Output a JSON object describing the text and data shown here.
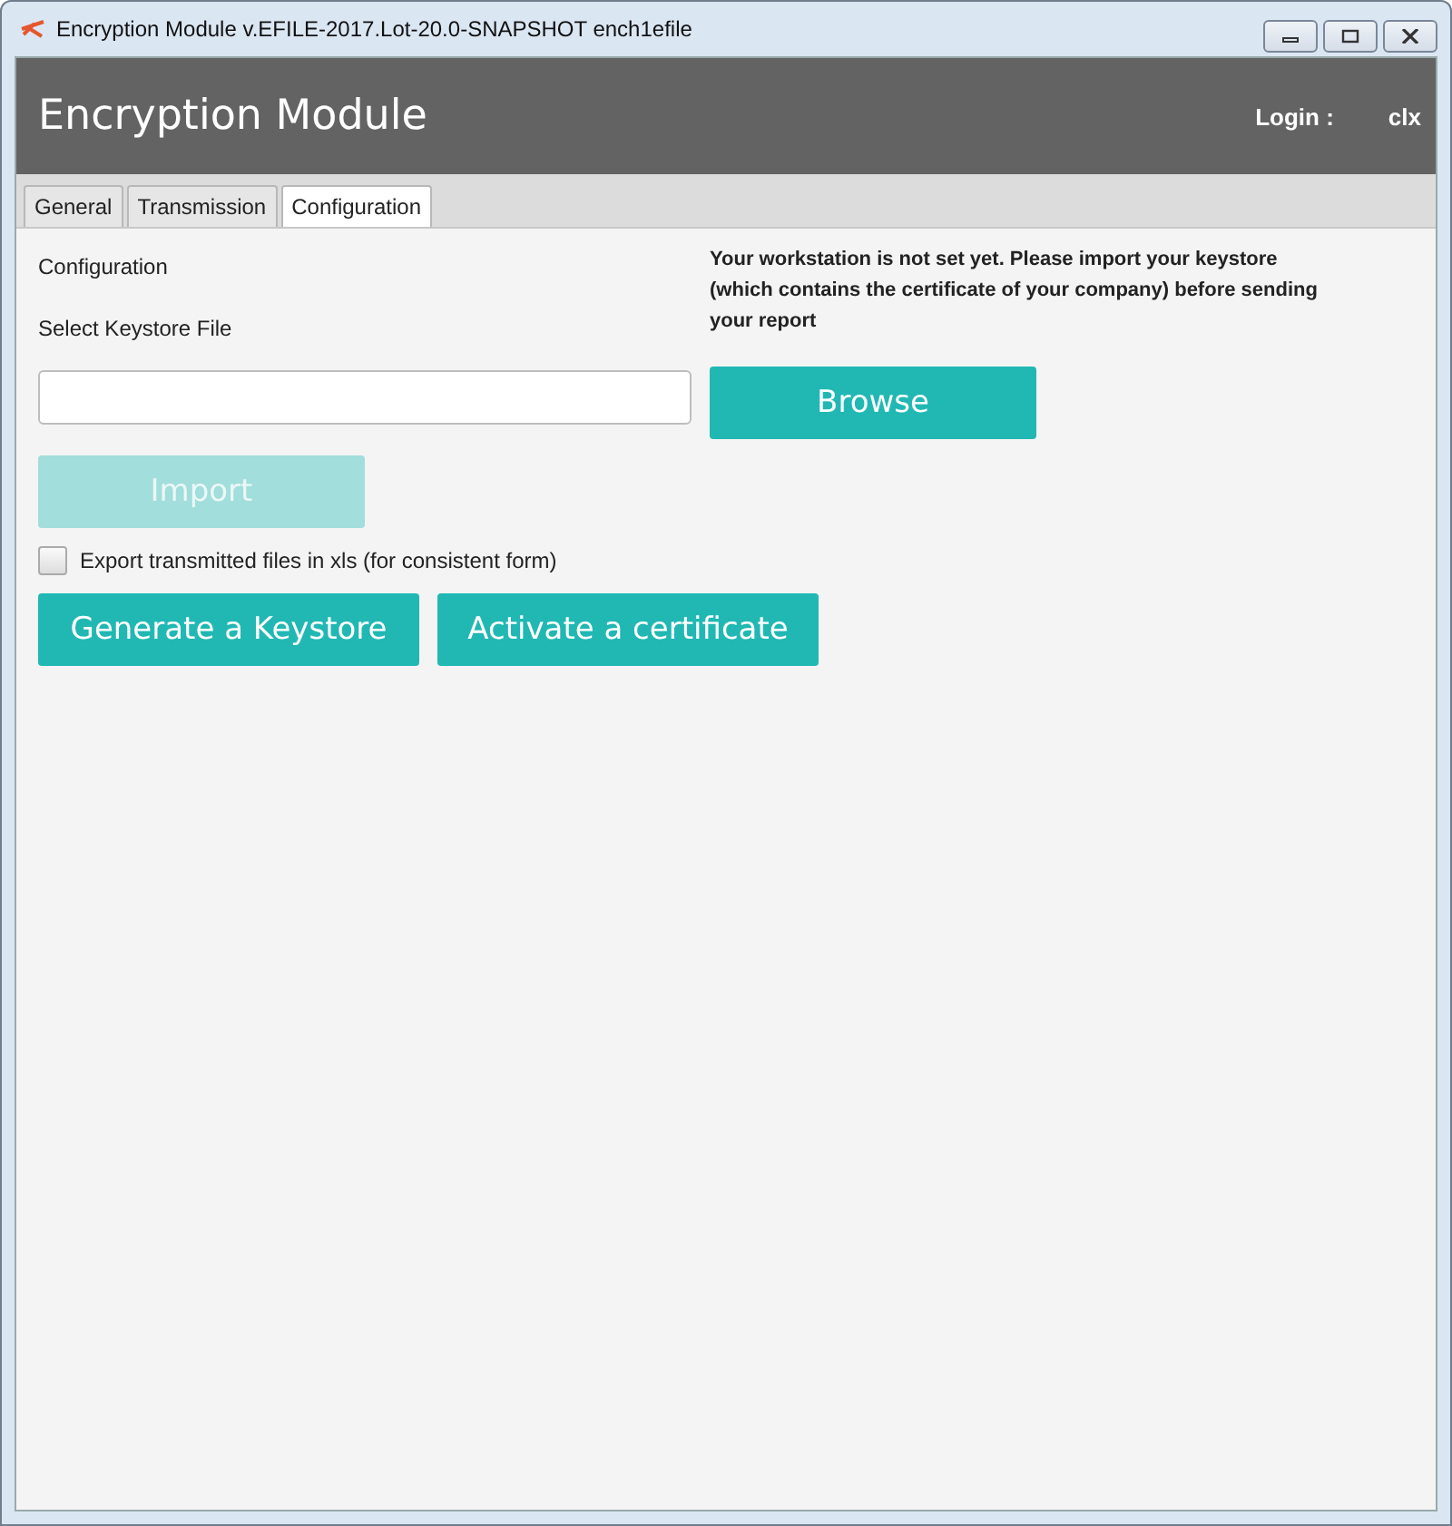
{
  "window": {
    "title": "Encryption Module v.EFILE-2017.Lot-20.0-SNAPSHOT ench1efile"
  },
  "header": {
    "title": "Encryption Module",
    "login_label": "Login :",
    "login_value": "clx"
  },
  "tabs": [
    {
      "label": "General",
      "selected": false
    },
    {
      "label": "Transmission",
      "selected": false
    },
    {
      "label": "Configuration",
      "selected": true
    }
  ],
  "section_title": "Configuration",
  "keystore_label": "Select Keystore File",
  "message": "Your workstation is not set yet. Please import your keystore (which contains the certificate of your company) before sending your report",
  "browse_button": {
    "label": "Browse"
  },
  "import_button": {
    "label": "Import",
    "disabled": true
  },
  "export_checkbox": {
    "label": "Export transmitted files in xls (for consistent form)",
    "checked": false
  },
  "action_buttons": [
    "Generate a Keystore",
    "Activate a certificate"
  ]
}
